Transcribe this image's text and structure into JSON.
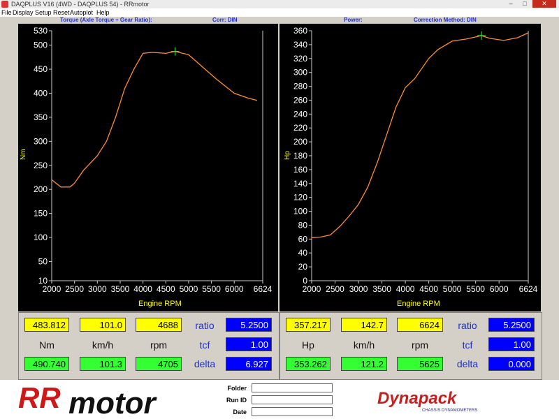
{
  "window": {
    "title": "DAQPLUS V16 (4WD - DAQPLUS 54) - RRmotor",
    "min_label": "–",
    "max_label": "□",
    "close_label": "✕"
  },
  "menu": [
    "File",
    "Display",
    "Setup",
    "Reset",
    "Autoplot",
    "Help"
  ],
  "legend_colors": [
    "#ff0000",
    "#00ff00",
    "#1e90ff",
    "#ff00ff",
    "#00ffff",
    "#ff8c00"
  ],
  "left_panel": {
    "header_title": "Torque (Axle Torque ÷ Gear Ratio):",
    "header_corr": "Corr: DIN",
    "ylabel": "Nm",
    "xlabel": "Engine RPM",
    "y_ticks": [
      "530",
      "500",
      "450",
      "400",
      "350",
      "300",
      "250",
      "200",
      "150",
      "100",
      "50",
      "10"
    ],
    "x_ticks": [
      "2000",
      "2500",
      "3000",
      "3500",
      "4000",
      "4500",
      "5000",
      "5500",
      "6000",
      "6624"
    ]
  },
  "right_panel": {
    "header_title": "Power:",
    "header_corr": "Correction Method: DIN",
    "ylabel": "Hp",
    "xlabel": "Engine RPM",
    "y_ticks": [
      "360",
      "340",
      "320",
      "300",
      "280",
      "260",
      "240",
      "220",
      "200",
      "180",
      "160",
      "140",
      "120",
      "100",
      "80",
      "60",
      "40",
      "20",
      "0"
    ],
    "x_ticks": [
      "2000",
      "2500",
      "3000",
      "3500",
      "4000",
      "4500",
      "5000",
      "5500",
      "6000",
      "6624"
    ]
  },
  "chart_data": [
    {
      "type": "line",
      "xlabel": "Engine RPM",
      "ylabel": "Nm",
      "xlim": [
        2000,
        6624
      ],
      "ylim": [
        10,
        530
      ],
      "series": [
        {
          "color": "#ff8c2a",
          "x": [
            2000,
            2200,
            2400,
            2500,
            2700,
            3000,
            3200,
            3400,
            3600,
            3800,
            4000,
            4200,
            4500,
            4700,
            5000,
            5300,
            5600,
            6000,
            6300,
            6500
          ],
          "y": [
            220,
            205,
            205,
            213,
            240,
            270,
            300,
            350,
            410,
            450,
            483,
            485,
            483,
            487,
            480,
            455,
            430,
            400,
            390,
            385
          ]
        }
      ],
      "marker": {
        "x": 4705,
        "y": 487
      }
    },
    {
      "type": "line",
      "xlabel": "Engine RPM",
      "ylabel": "Hp",
      "xlim": [
        2000,
        6624
      ],
      "ylim": [
        0,
        360
      ],
      "series": [
        {
          "color": "#ff8c2a",
          "x": [
            2000,
            2200,
            2400,
            2600,
            2800,
            3000,
            3200,
            3400,
            3600,
            3800,
            4000,
            4200,
            4500,
            4700,
            5000,
            5300,
            5625,
            5800,
            6100,
            6400,
            6624
          ],
          "y": [
            62,
            63,
            66,
            78,
            93,
            110,
            135,
            170,
            210,
            250,
            278,
            291,
            320,
            333,
            345,
            348,
            353,
            349,
            346,
            350,
            357
          ]
        }
      ],
      "marker": {
        "x": 5625,
        "y": 353
      }
    }
  ],
  "left_readout": {
    "v1": "483.812",
    "v2": "101.0",
    "v3": "4688",
    "u1": "Nm",
    "u2": "km/h",
    "u3": "rpm",
    "g1": "490.740",
    "g2": "101.3",
    "g3": "4705",
    "ratio_label": "ratio",
    "ratio_value": "5.2500",
    "tcf_label": "tcf",
    "tcf_value": "1.00",
    "delta_label": "delta",
    "delta_value": "6.927"
  },
  "right_readout": {
    "v1": "357.217",
    "v2": "142.7",
    "v3": "6624",
    "u1": "Hp",
    "u2": "km/h",
    "u3": "rpm",
    "g1": "353.262",
    "g2": "121.2",
    "g3": "5625",
    "ratio_label": "ratio",
    "ratio_value": "5.2500",
    "tcf_label": "tcf",
    "tcf_value": "1.00",
    "delta_label": "delta",
    "delta_value": "0.000"
  },
  "footer": {
    "brand_rr": "RR",
    "brand_motor": "motor",
    "folder_label": "Folder",
    "runid_label": "Run ID",
    "date_label": "Date",
    "folder_value": "",
    "runid_value": "",
    "date_value": "",
    "dyna_brand": "Dynapack",
    "dyna_sub": "CHASSIS DYNAMOMETERS"
  }
}
